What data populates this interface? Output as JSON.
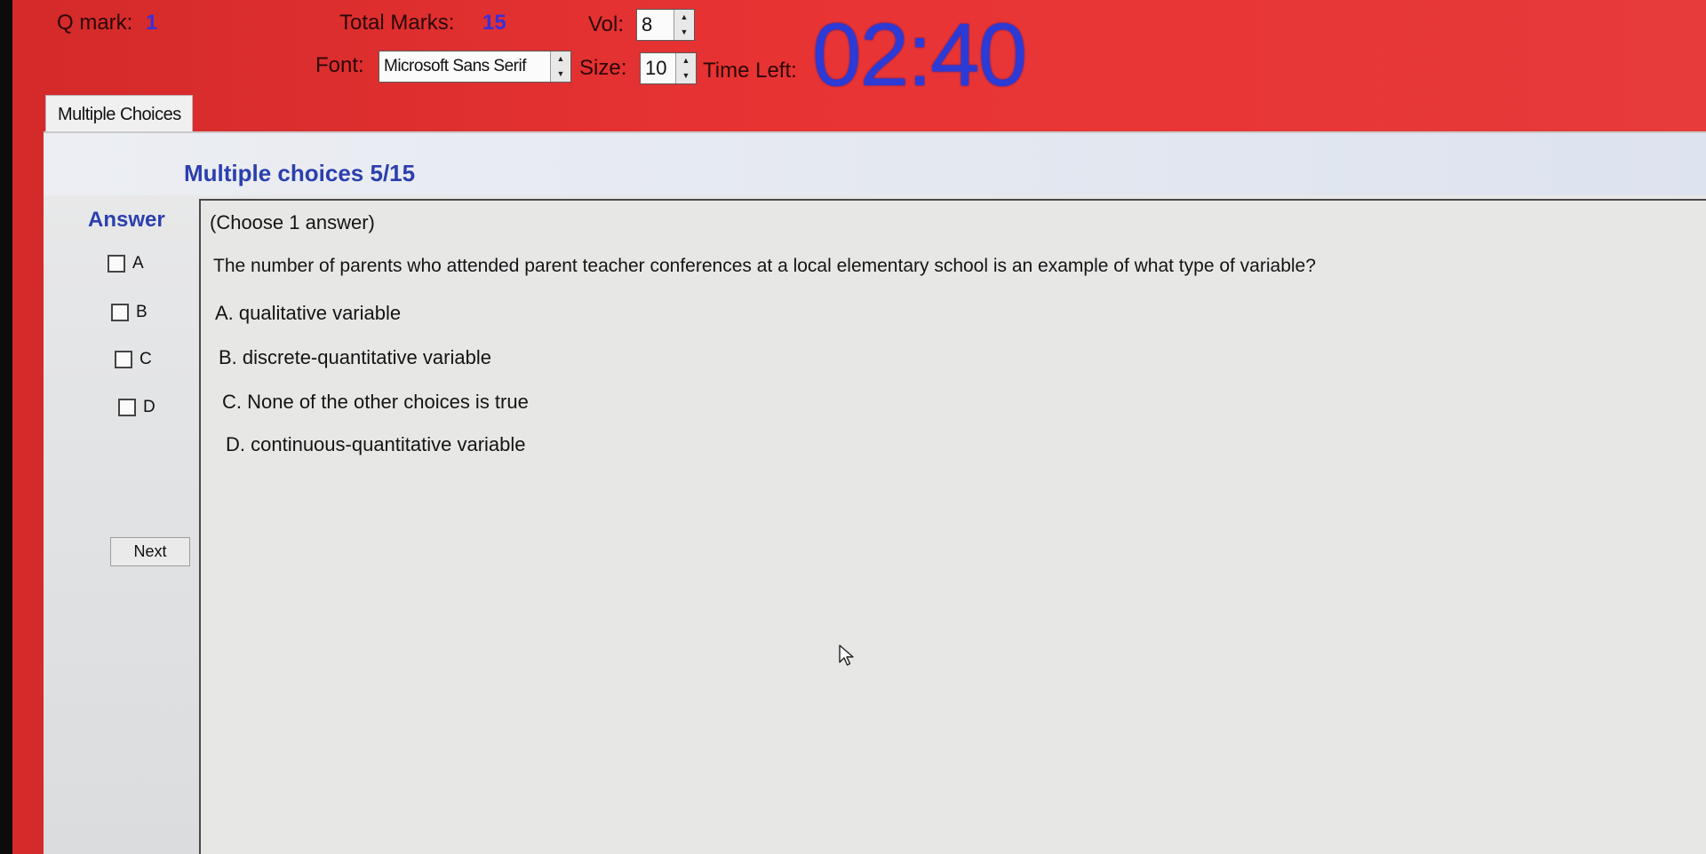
{
  "header": {
    "q_mark_label": "Q mark:",
    "q_mark_value": "1",
    "total_marks_label": "Total Marks:",
    "total_marks_value": "15",
    "vol_label": "Vol:",
    "vol_value": "8",
    "font_label": "Font:",
    "font_value": "Microsoft Sans Serif",
    "size_label": "Size:",
    "size_value": "10",
    "time_left_label": "Time Left:",
    "timer_value": "02:40"
  },
  "tab": {
    "label": "Multiple Choices"
  },
  "main": {
    "title": "Multiple choices 5/15",
    "answer_label": "Answer",
    "instruction": "(Choose 1 answer)",
    "question": "The number of parents who attended parent teacher conferences at a local elementary school is an example of what type of variable?",
    "answer_options": [
      {
        "label": "A"
      },
      {
        "label": "B"
      },
      {
        "label": "C"
      },
      {
        "label": "D"
      }
    ],
    "choices": [
      "A.  qualitative variable",
      "B.  discrete-quantitative variable",
      "C.  None of the other choices is true",
      "D.  continuous-quantitative variable"
    ],
    "next_label": "Next"
  },
  "colors": {
    "background": "#e53333",
    "accent_blue": "#2b3fae",
    "timer": "#2c3ad6"
  }
}
